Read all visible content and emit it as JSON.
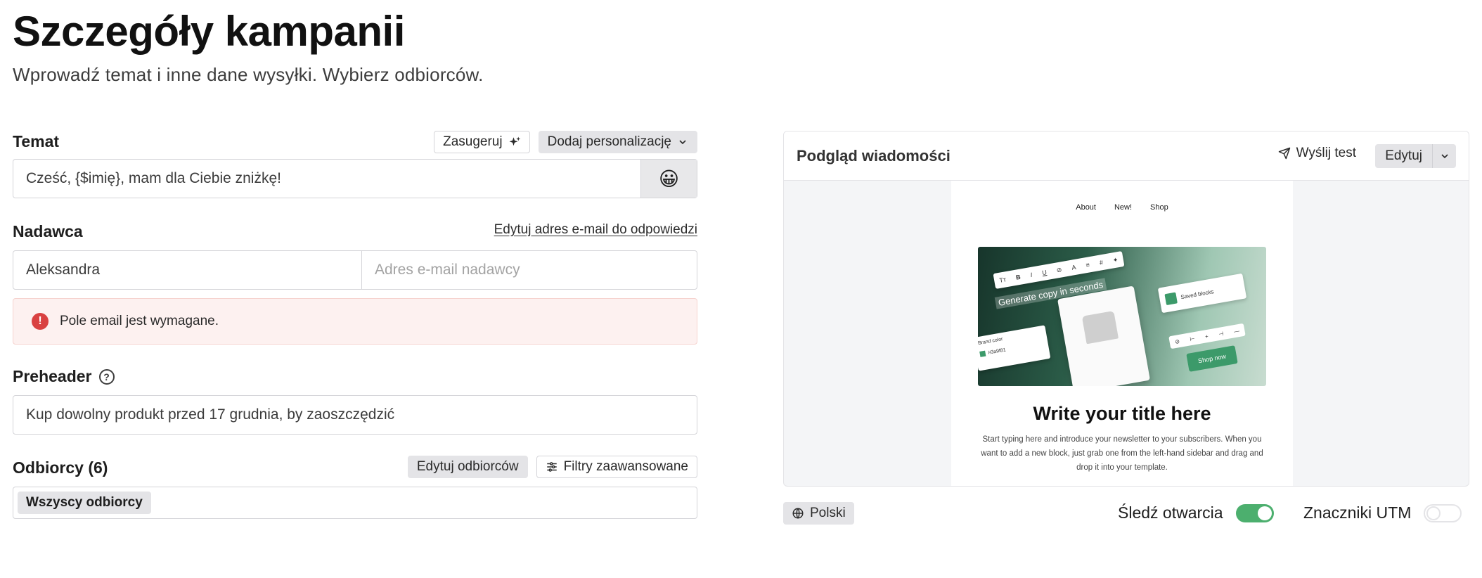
{
  "page": {
    "title": "Szczegóły kampanii",
    "subtitle": "Wprowadź temat i inne dane wysyłki. Wybierz odbiorców."
  },
  "subject": {
    "label": "Temat",
    "suggest_label": "Zasugeruj",
    "personalize_label": "Dodaj personalizację",
    "value": "Cześć, {$imię}, mam dla Ciebie zniżkę!",
    "emoji": "😀"
  },
  "sender": {
    "label": "Nadawca",
    "reply_link": "Edytuj adres e-mail do odpowiedzi",
    "name_value": "Aleksandra",
    "email_placeholder": "Adres e-mail nadawcy",
    "error_text": "Pole email jest wymagane."
  },
  "preheader": {
    "label": "Preheader",
    "value": "Kup dowolny produkt przed 17 grudnia, by zaoszczędzić"
  },
  "recipients": {
    "label": "Odbiorcy (6)",
    "edit_label": "Edytuj odbiorców",
    "filters_label": "Filtry zaawansowane",
    "tag": "Wszyscy odbiorcy"
  },
  "preview": {
    "title": "Podgląd wiadomości",
    "send_test_label": "Wyślij test",
    "edit_label": "Edytuj",
    "email": {
      "nav": [
        "About",
        "New!",
        "Shop"
      ],
      "hero_text": "Generate copy in seconds",
      "saved_blocks": "Saved blocks",
      "brand_color": "Brand color",
      "brand_hex": "#3a9f81",
      "shop_now": "Shop now",
      "title": "Write your title here",
      "body": "Start typing here and introduce your newsletter to your subscribers. When you want to add a new block, just grab one from the left-hand sidebar and drag and drop it into your template."
    }
  },
  "footer": {
    "language_label": "Polski",
    "track_opens_label": "Śledź otwarcia",
    "track_opens_on": true,
    "utm_label": "Znaczniki UTM",
    "utm_on": false
  },
  "colors": {
    "toggle_on": "#4caf6e",
    "error_bg": "#fdf1f0",
    "error_icon": "#d94141",
    "chip_bg": "#e4e4e7"
  }
}
